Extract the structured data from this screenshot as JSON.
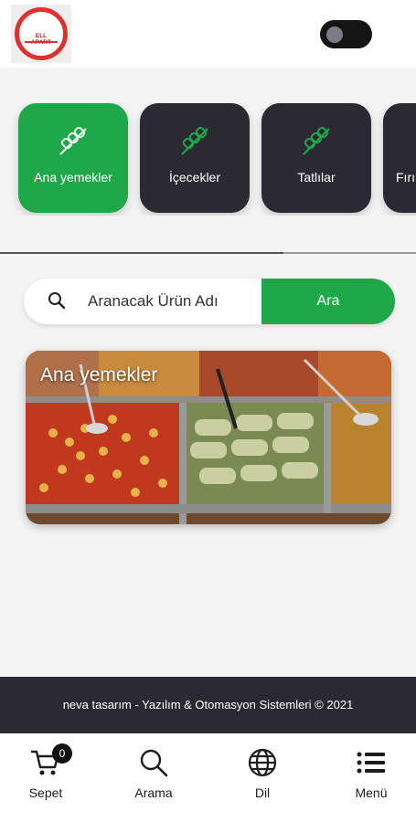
{
  "header": {
    "logo_text": "ELL APART",
    "theme_toggle_on": false
  },
  "categories": [
    {
      "label": "Ana yemekler",
      "active": true,
      "icon": "kebab-icon"
    },
    {
      "label": "İçecekler",
      "active": false,
      "icon": "kebab-icon"
    },
    {
      "label": "Tatlılar",
      "active": false,
      "icon": "kebab-icon"
    },
    {
      "label": "Fırı",
      "active": false,
      "icon": "kebab-icon"
    }
  ],
  "search": {
    "placeholder": "Aranacak Ürün Adı",
    "button_label": "Ara"
  },
  "food_card": {
    "title": "Ana yemekler"
  },
  "footer": {
    "text": "neva tasarım - Yazılım & Otomasyon Sistemleri © 2021"
  },
  "bottom_nav": {
    "items": [
      {
        "label": "Sepet",
        "icon": "cart-icon"
      },
      {
        "label": "Arama",
        "icon": "search-icon"
      },
      {
        "label": "Dil",
        "icon": "globe-icon"
      },
      {
        "label": "Menü",
        "icon": "menu-icon"
      }
    ],
    "cart_count": "0"
  },
  "colors": {
    "accent_green": "#1ea84a",
    "dark": "#2b2a33",
    "logo_red": "#e03131"
  }
}
